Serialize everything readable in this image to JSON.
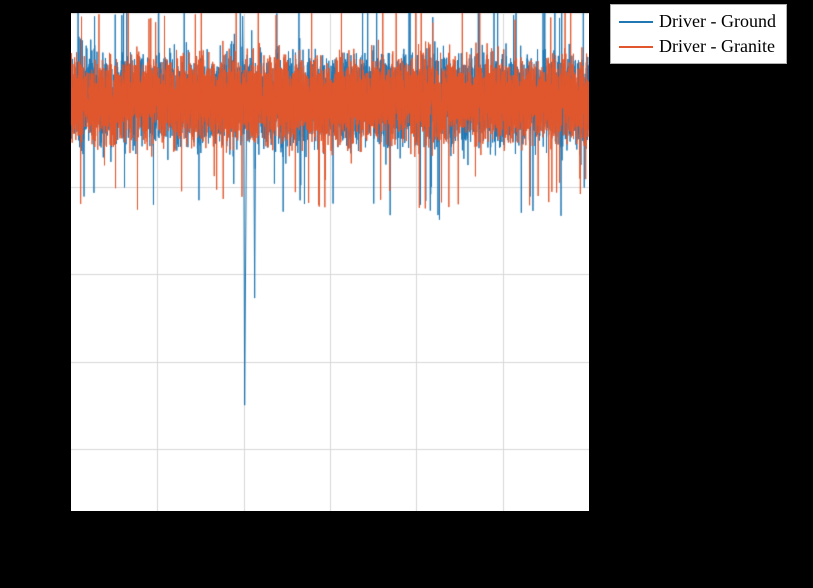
{
  "chart_data": {
    "type": "line",
    "title": "",
    "xlabel": "",
    "ylabel": "",
    "xlim": [
      0,
      6000
    ],
    "ylim": [
      -0.06,
      0.02
    ],
    "x_gridlines": [
      1000,
      2000,
      3000,
      4000,
      5000
    ],
    "y_gridlines": [
      0.02,
      0.006,
      -0.008,
      -0.022,
      -0.036,
      -0.05
    ],
    "legend_position": "outside-right-top",
    "series": [
      {
        "name": "Driver - Ground",
        "color": "#1f77b4",
        "kind": "noise",
        "mean": 0.006,
        "amplitude": 0.012,
        "spike": {
          "x": 2000,
          "low": -0.043,
          "high": 0.0195
        },
        "n": 6000
      },
      {
        "name": "Driver - Granite",
        "color": "#e1562c",
        "kind": "noise",
        "mean": 0.006,
        "amplitude": 0.011,
        "n": 6000
      }
    ]
  },
  "legend": {
    "items": [
      {
        "label": "Driver - Ground",
        "color": "#1f77b4"
      },
      {
        "label": "Driver - Granite",
        "color": "#e1562c"
      }
    ]
  }
}
